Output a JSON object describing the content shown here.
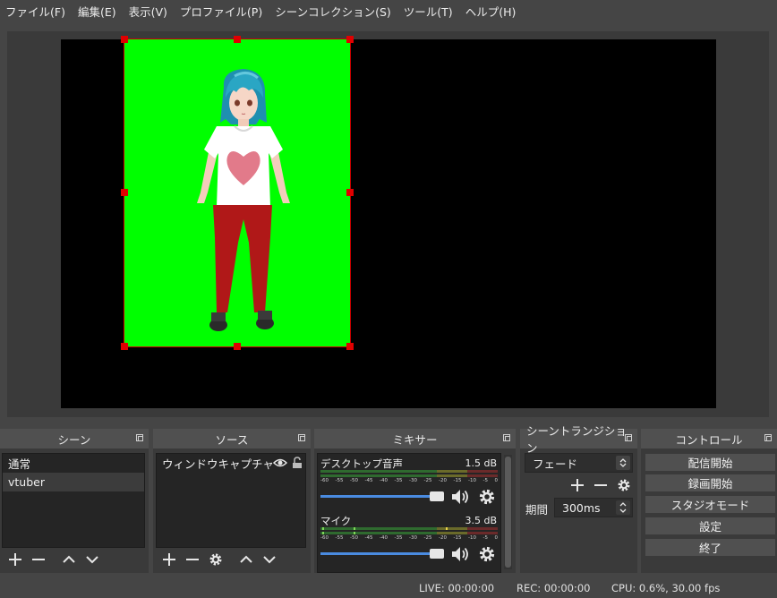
{
  "menu": [
    "ファイル(F)",
    "編集(E)",
    "表示(V)",
    "プロファイル(P)",
    "シーンコレクション(S)",
    "ツール(T)",
    "ヘルプ(H)"
  ],
  "scenes": {
    "title": "シーン",
    "items": [
      "通常",
      "vtuber"
    ],
    "selected": "vtuber"
  },
  "sources": {
    "title": "ソース",
    "items": [
      {
        "label": "ウィンドウキャプチャ",
        "visible": true,
        "locked": false
      }
    ]
  },
  "mixer": {
    "title": "ミキサー",
    "channels": [
      {
        "name": "デスクトップ音声",
        "db": "1.5 dB",
        "volume_fraction": 0.95
      },
      {
        "name": "マイク",
        "db": "3.5 dB",
        "volume_fraction": 0.95
      }
    ],
    "scale": [
      "-60",
      "-55",
      "-50",
      "-45",
      "-40",
      "-35",
      "-30",
      "-25",
      "-20",
      "-15",
      "-10",
      "-5",
      "0"
    ]
  },
  "transitions": {
    "title": "シーントランジション",
    "selected": "フェード",
    "duration_label": "期間",
    "duration_value": "300ms"
  },
  "controls": {
    "title": "コントロール",
    "buttons": [
      "配信開始",
      "録画開始",
      "スタジオモード",
      "設定",
      "終了"
    ]
  },
  "status": {
    "live": "LIVE: 00:00:00",
    "rec": "REC: 00:00:00",
    "cpu": "CPU: 0.6%, 30.00 fps"
  },
  "colors": {
    "background": "#454545",
    "panel": "#3a3a3a",
    "chroma": "#00ff00",
    "selection_handle": "#e00000",
    "volume_slider": "#4a8be0"
  },
  "icons": [
    "plus-icon",
    "minus-icon",
    "chevron-up-icon",
    "chevron-down-icon",
    "gear-icon",
    "eye-icon",
    "lock-icon",
    "speaker-icon",
    "float-icon"
  ]
}
